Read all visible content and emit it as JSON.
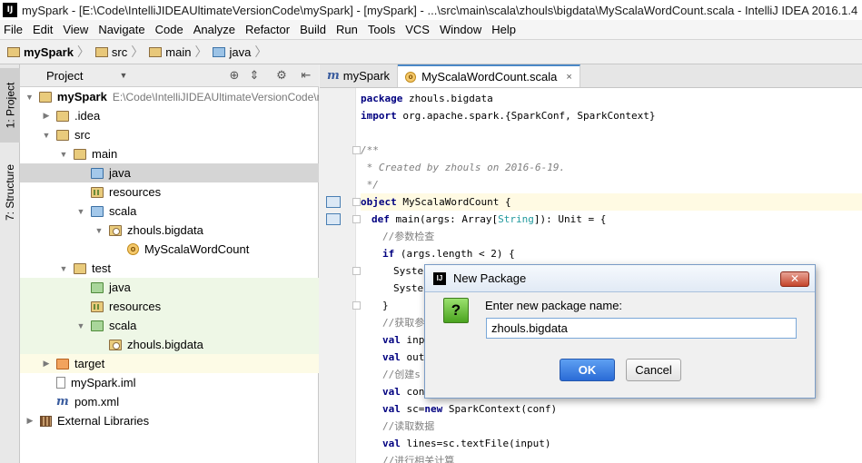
{
  "window": {
    "title": "mySpark - [E:\\Code\\IntelliJIDEAUltimateVersionCode\\mySpark] - [mySpark] - ...\\src\\main\\scala\\zhouls\\bigdata\\MyScalaWordCount.scala - IntelliJ IDEA 2016.1.4",
    "logo": "IJ"
  },
  "menu": [
    "File",
    "Edit",
    "View",
    "Navigate",
    "Code",
    "Analyze",
    "Refactor",
    "Build",
    "Run",
    "Tools",
    "VCS",
    "Window",
    "Help"
  ],
  "breadcrumb": [
    "mySpark",
    "src",
    "main",
    "java"
  ],
  "tool_strip": {
    "project_tab": "1: Project",
    "structure_tab": "7: Structure"
  },
  "project_panel": {
    "header_label": "Project",
    "tree": [
      {
        "label": "mySpark",
        "path": "E:\\Code\\IntelliJIDEAUltimateVersionCode\\mySpark"
      },
      {
        "label": ".idea"
      },
      {
        "label": "src"
      },
      {
        "label": "main"
      },
      {
        "label": "java"
      },
      {
        "label": "resources"
      },
      {
        "label": "scala"
      },
      {
        "label": "zhouls.bigdata"
      },
      {
        "label": "MyScalaWordCount"
      },
      {
        "label": "test"
      },
      {
        "label": "java"
      },
      {
        "label": "resources"
      },
      {
        "label": "scala"
      },
      {
        "label": "zhouls.bigdata"
      },
      {
        "label": "target"
      },
      {
        "label": "mySpark.iml"
      },
      {
        "label": "pom.xml"
      },
      {
        "label": "External Libraries"
      }
    ]
  },
  "editor": {
    "tabs": [
      {
        "label": "mySpark",
        "icon": "maven-icon"
      },
      {
        "label": "MyScalaWordCount.scala",
        "icon": "scala-object-icon",
        "close": "×"
      }
    ],
    "code": {
      "l1_kw": "package",
      "l1_rest": " zhouls.bigdata",
      "l2_kw": "import",
      "l2_rest": " org.apache.spark.{SparkConf, SparkContext}",
      "l4": "/**",
      "l5": " * Created by zhouls on 2016-6-19.",
      "l6": " */",
      "l7_kw": "object",
      "l7_rest": " MyScalaWordCount {",
      "l8_kw": "def",
      "l8_a": " main(args: Array[",
      "l8_ty": "String",
      "l8_b": "]): Unit = {",
      "l9": "//参数检查",
      "l10_kw": "if",
      "l10_rest": " (args.length < 2) {",
      "l11": "Syste",
      "l12": "Syste",
      "l13": "}",
      "l14": "//获取参",
      "l15_kw": "val",
      "l15_rest": " inp",
      "l16_kw": "val",
      "l16_rest": " out",
      "l17": "//创建s",
      "l18_kw": "val",
      "l18_rest": " con",
      "l19_kw": "val",
      "l19_a": " sc=",
      "l19_kw2": "new",
      "l19_b": " SparkContext(conf)",
      "l20": "//读取数据",
      "l21_kw": "val",
      "l21_rest": " lines=sc.textFile(input)",
      "l22": "//进行相关计算"
    }
  },
  "dialog": {
    "title": "New Package",
    "logo": "IJ",
    "close": "✕",
    "question": "?",
    "prompt": "Enter new package name:",
    "input_value": "zhouls.bigdata",
    "ok_label": "OK",
    "cancel_label": "Cancel"
  },
  "colors": {
    "accent": "#4a88c7",
    "ok_button": "#2a6bd6",
    "keyword": "#000080",
    "comment": "#808080"
  }
}
